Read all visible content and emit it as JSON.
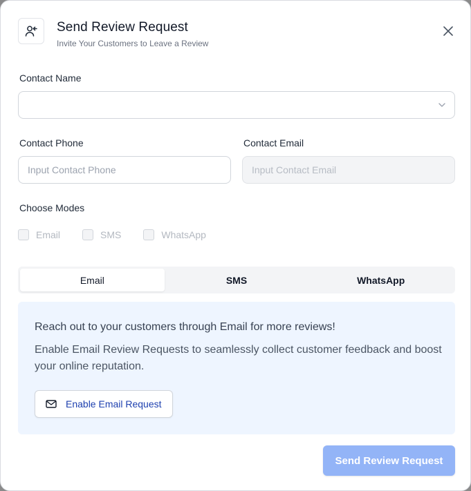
{
  "header": {
    "icon": "user-arrow-icon",
    "title": "Send Review Request",
    "subtitle": "Invite Your Customers to Leave a Review",
    "close_icon": "close-icon"
  },
  "form": {
    "contact_name": {
      "label": "Contact Name",
      "value": ""
    },
    "contact_phone": {
      "label": "Contact Phone",
      "placeholder": "Input Contact Phone"
    },
    "contact_email": {
      "label": "Contact Email",
      "placeholder": "Input Contact Email"
    },
    "modes": {
      "label": "Choose Modes",
      "options": [
        "Email",
        "SMS",
        "WhatsApp"
      ]
    }
  },
  "tabs": {
    "items": [
      "Email",
      "SMS",
      "WhatsApp"
    ],
    "active": "Email"
  },
  "info": {
    "line1": "Reach out to your customers through Email for more reviews!",
    "line2": "Enable Email Review Requests to seamlessly collect customer feedback and boost your online reputation.",
    "button_label": "Enable Email Request",
    "button_icon": "mail-icon"
  },
  "footer": {
    "send_label": "Send Review Request"
  },
  "colors": {
    "accent": "#93b4f7",
    "link": "#1e40af",
    "panel_bg": "#eef5ff"
  }
}
